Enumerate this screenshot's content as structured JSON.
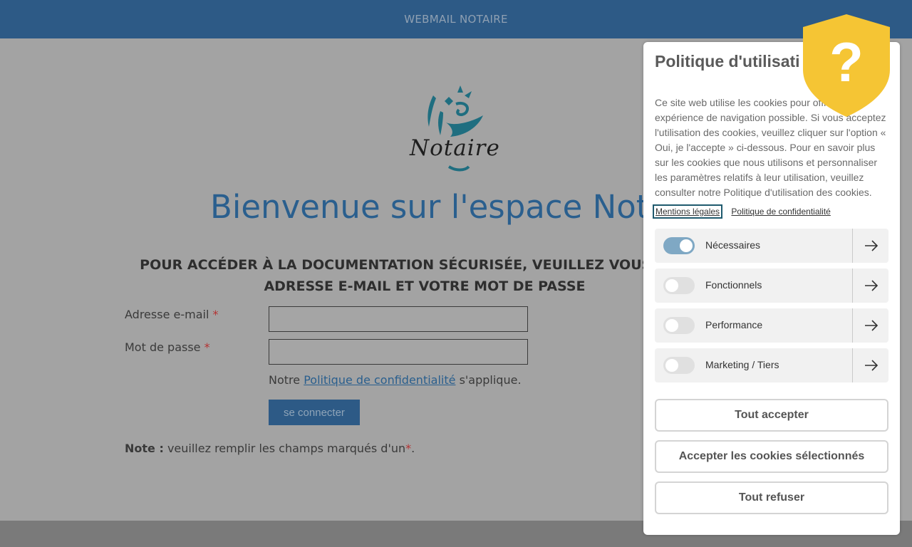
{
  "header": {
    "title": "WEBMAIL NOTAIRE"
  },
  "logo": {
    "text": "Notaire"
  },
  "main": {
    "welcome": "Bienvenue sur l'espace Not",
    "instructions": "POUR ACCÉDER À LA DOCUMENTATION SÉCURISÉE, VEUILLEZ VOUS CONNE ADRESSE E-MAIL ET VOTRE MOT DE PASSE",
    "email_label": "Adresse e-mail",
    "password_label": "Mot de passe",
    "required_mark": "*",
    "email_value": "",
    "password_value": "",
    "notice_prefix": "Notre",
    "notice_link": "Politique de confidentialité",
    "notice_suffix": "s'applique.",
    "login_button": "se connecter",
    "note_bold": "Note :",
    "note_text": "veuillez remplir les champs marqués d'un",
    "note_end": "."
  },
  "cookie_panel": {
    "title": "Politique d'utilisati cookies",
    "close": "×",
    "text": "Ce site web utilise les cookies pour offr eure expérience de navigation possible. Si vous acceptez l'utilisation des cookies, veuillez cliquer sur l'option « Oui, je l'accepte » ci-dessous. Pour en savoir plus sur les cookies que nous utilisons et personnaliser les paramètres relatifs à leur utilisation, veuillez consulter notre Politique d'utilisation des cookies.",
    "link_legal": "Mentions légales",
    "link_privacy": "Politique de confidentialité",
    "categories": [
      {
        "label": "Nécessaires",
        "enabled": true
      },
      {
        "label": "Fonctionnels",
        "enabled": false
      },
      {
        "label": "Performance",
        "enabled": false
      },
      {
        "label": "Marketing / Tiers",
        "enabled": false
      }
    ],
    "buttons": {
      "accept_all": "Tout accepter",
      "accept_selected": "Accepter les cookies sélectionnés",
      "refuse_all": "Tout refuser"
    }
  },
  "badge": {
    "symbol": "?",
    "color": "#f5c534"
  },
  "colors": {
    "brand": "#2d5a86",
    "accent": "#2a5f8e",
    "required": "#b53333"
  }
}
